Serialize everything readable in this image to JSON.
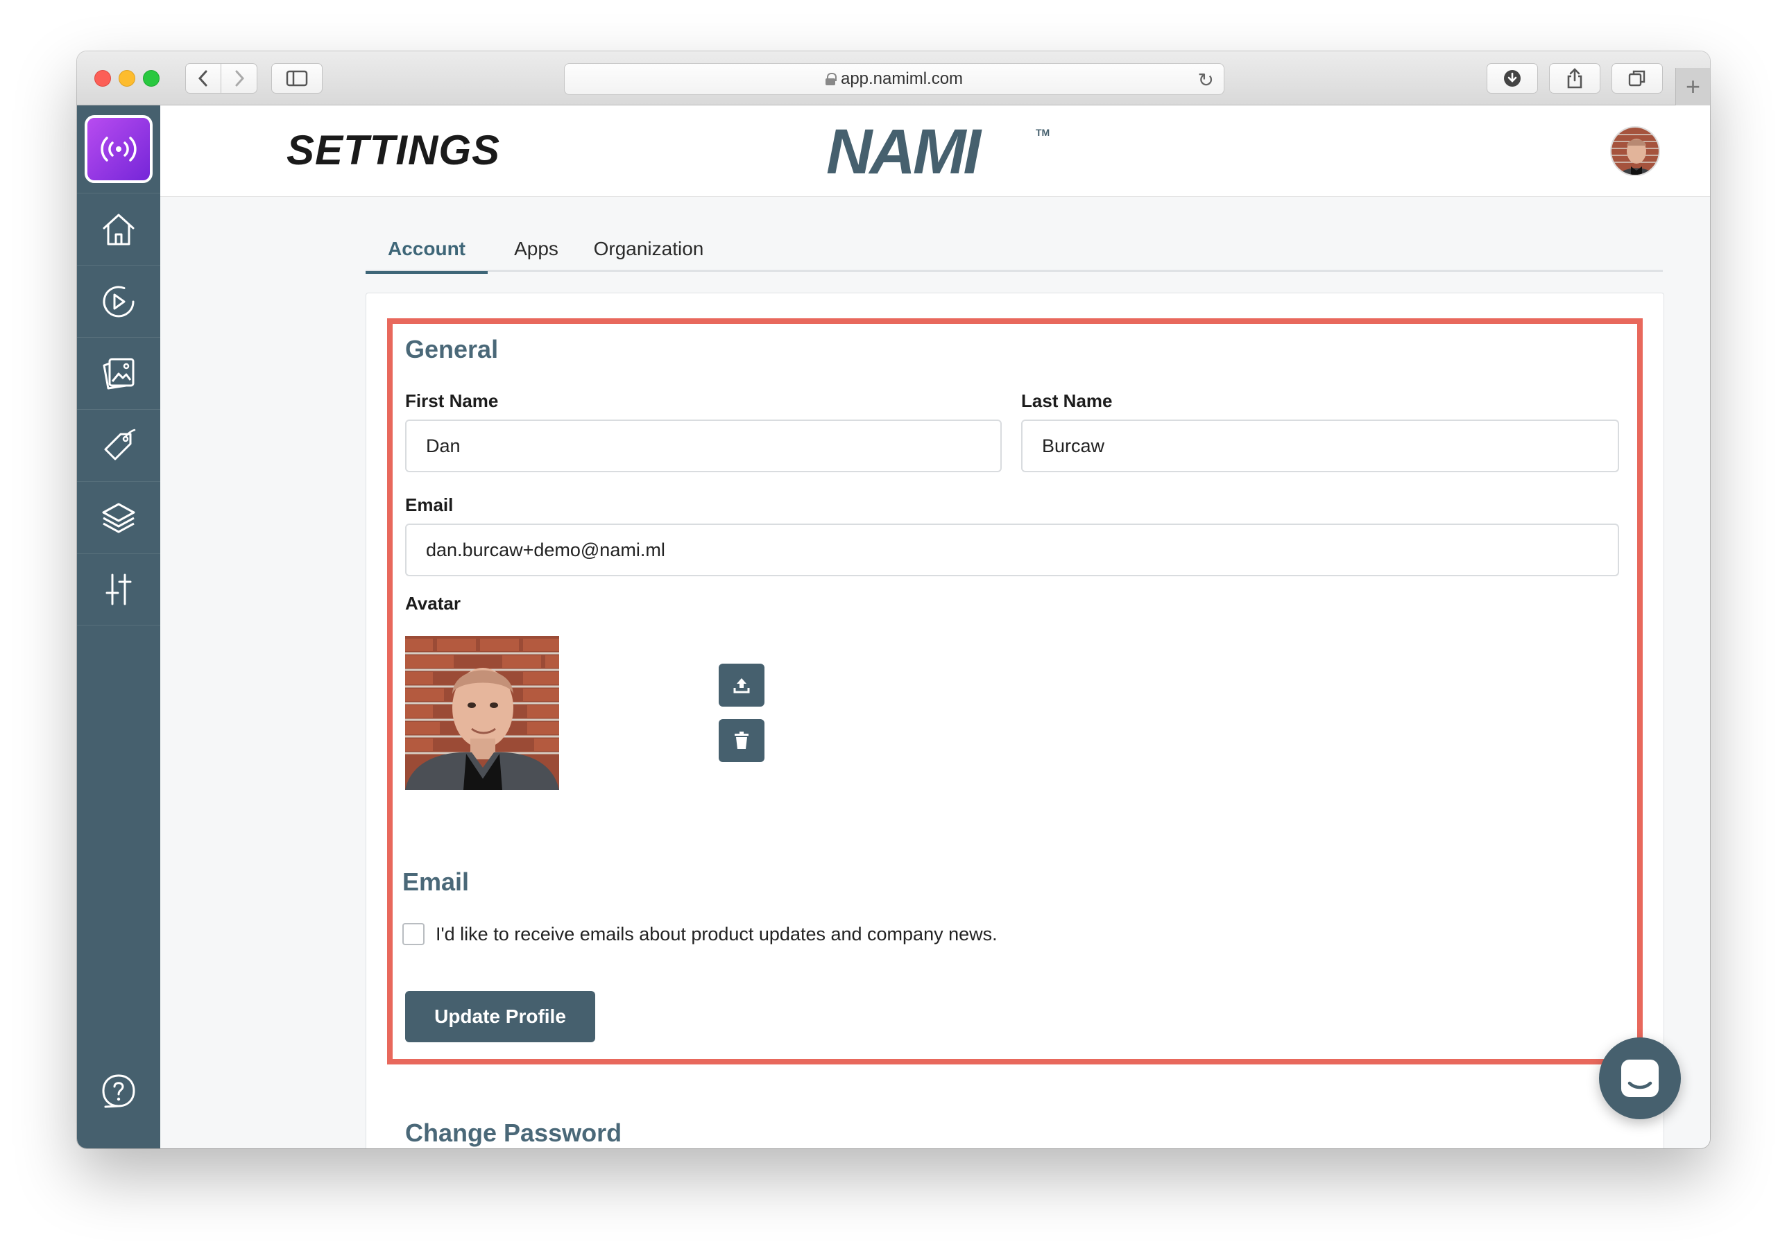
{
  "browser": {
    "url": "app.namiml.com"
  },
  "header": {
    "title": "SETTINGS",
    "brand": "NAMI",
    "trademark": "TM"
  },
  "tabs": [
    {
      "label": "Account",
      "active": true
    },
    {
      "label": "Apps",
      "active": false
    },
    {
      "label": "Organization",
      "active": false
    }
  ],
  "general": {
    "title": "General",
    "first_name_label": "First Name",
    "first_name_value": "Dan",
    "last_name_label": "Last Name",
    "last_name_value": "Burcaw",
    "email_label": "Email",
    "email_value": "dan.burcaw+demo@nami.ml",
    "avatar_label": "Avatar"
  },
  "email_prefs": {
    "title": "Email",
    "checkbox_label": "I'd like to receive emails about product updates and company news.",
    "checked": false
  },
  "actions": {
    "update_label": "Update Profile"
  },
  "password": {
    "title": "Change Password"
  },
  "colors": {
    "sidebar": "#46606e",
    "accent": "#3e6678",
    "highlight": "#e8685c",
    "app_logo": "#9b3ee6"
  },
  "icons": {
    "sidebar": [
      "home-icon",
      "play-icon",
      "gallery-icon",
      "tag-icon",
      "layers-icon",
      "sliders-icon",
      "help-icon"
    ]
  }
}
